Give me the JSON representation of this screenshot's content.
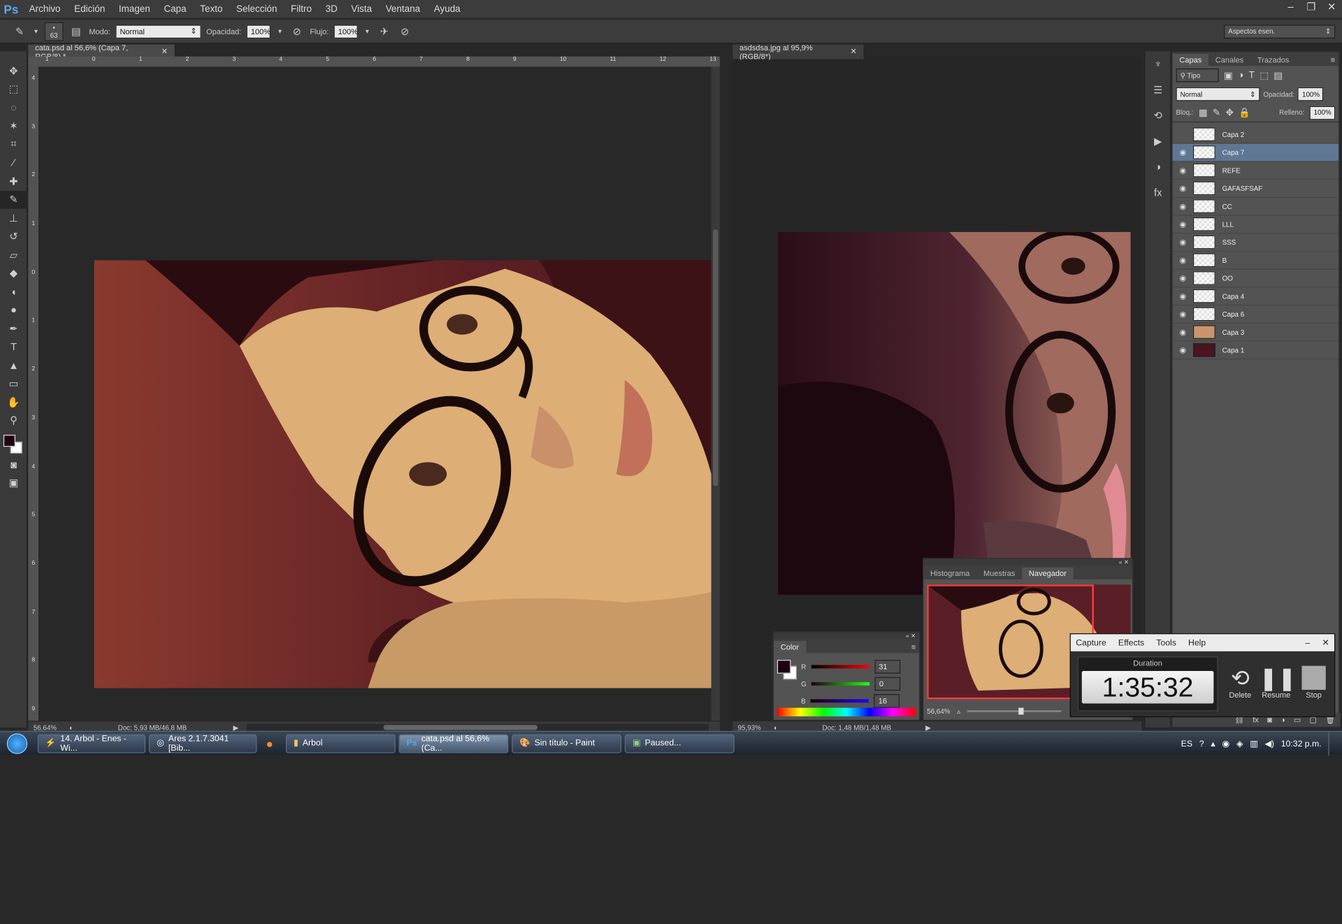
{
  "app": {
    "logo": "Ps",
    "menus": [
      "Archivo",
      "Edición",
      "Imagen",
      "Capa",
      "Texto",
      "Selección",
      "Filtro",
      "3D",
      "Vista",
      "Ventana",
      "Ayuda"
    ],
    "workspace": "Aspectos esen."
  },
  "options": {
    "brush_size": "63",
    "mode_label": "Modo:",
    "mode_value": "Normal",
    "opacity_label": "Opacidad:",
    "opacity_value": "100%",
    "flow_label": "Flujo:",
    "flow_value": "100%"
  },
  "doc1": {
    "tab": "cata.psd al 56,6% (Capa 7, RGB/8) *",
    "zoom": "56,64%",
    "doc_size": "Doc: 5,93 MB/46,8 MB",
    "ruler_top": [
      "1",
      "0",
      "1",
      "2",
      "3",
      "4",
      "5",
      "6",
      "7",
      "8",
      "9",
      "10",
      "11",
      "12",
      "13"
    ],
    "ruler_left": [
      "4",
      "3",
      "2",
      "1",
      "0",
      "1",
      "2",
      "3",
      "4",
      "5",
      "6",
      "7",
      "8",
      "9"
    ]
  },
  "doc2": {
    "tab": "asdsdsa.jpg al 95,9% (RGB/8*)",
    "zoom": "95,93%",
    "doc_size": "Doc: 1,48 MB/1,48 MB"
  },
  "layers_panel": {
    "tabs": [
      "Capas",
      "Canales",
      "Trazados"
    ],
    "filter": "Tipo",
    "blend": "Normal",
    "opacity_label": "Opacidad:",
    "opacity_value": "100%",
    "lock_label": "Bloq.:",
    "fill_label": "Relleno:",
    "fill_value": "100%",
    "layers": [
      {
        "name": "Capa 2",
        "visible": false,
        "selected": false
      },
      {
        "name": "Capa 7",
        "visible": true,
        "selected": true
      },
      {
        "name": "REFE",
        "visible": true,
        "selected": false
      },
      {
        "name": "GAFASFSAF",
        "visible": true,
        "selected": false
      },
      {
        "name": "CC",
        "visible": true,
        "selected": false
      },
      {
        "name": "LLL",
        "visible": true,
        "selected": false
      },
      {
        "name": "SSS",
        "visible": true,
        "selected": false
      },
      {
        "name": "B",
        "visible": true,
        "selected": false
      },
      {
        "name": "OO",
        "visible": true,
        "selected": false
      },
      {
        "name": "Capa 4",
        "visible": true,
        "selected": false
      },
      {
        "name": "Capa 6",
        "visible": true,
        "selected": false
      },
      {
        "name": "Capa 3",
        "visible": true,
        "selected": false
      },
      {
        "name": "Capa 1",
        "visible": true,
        "selected": false
      }
    ]
  },
  "navigator": {
    "tabs": [
      "Histograma",
      "Muestras",
      "Navegador"
    ],
    "zoom": "56,64%"
  },
  "color_panel": {
    "title": "Color",
    "r_label": "R",
    "r_value": "31",
    "g_label": "G",
    "g_value": "0",
    "b_label": "B",
    "b_value": "16",
    "foreground": "#1f0010"
  },
  "capture": {
    "menu": [
      "Capture",
      "Effects",
      "Tools",
      "Help"
    ],
    "duration_label": "Duration",
    "time": "1:35:32",
    "delete_label": "Delete",
    "resume_label": "Resume",
    "stop_label": "Stop"
  },
  "taskbar": {
    "tasks": [
      "14. Arbol - Enes - Wi...",
      "Ares 2.1.7.3041   [Bib...",
      "Arbol",
      "cata.psd al 56,6% (Ca...",
      "Sin título - Paint",
      "Paused..."
    ],
    "lang": "ES",
    "time": "10:32 p.m."
  }
}
